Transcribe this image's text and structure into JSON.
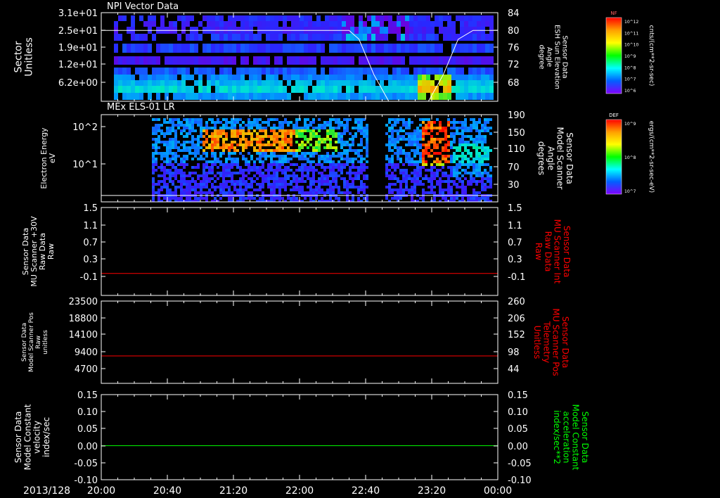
{
  "date_label": "2013/128",
  "x_axis": {
    "ticks": [
      "20:00",
      "20:40",
      "21:20",
      "22:00",
      "22:40",
      "23:20",
      "00:00"
    ]
  },
  "colorbars": [
    {
      "unit": "cnts/(cm**2-sr-sec)",
      "tag": "NF",
      "tick_labels": [
        "10^12",
        "10^11",
        "10^10",
        "10^9",
        "10^8",
        "10^7",
        "10^6"
      ],
      "colors": [
        "#ff0000",
        "#ffa000",
        "#ffff00",
        "#00ff00",
        "#00ffff",
        "#0060ff",
        "#8000ff"
      ]
    },
    {
      "unit": "ergs/(cm**2-sr-sec-eV)",
      "tag": "DEF",
      "tick_labels": [
        "10^9",
        "10^8",
        "10^7"
      ],
      "colors": [
        "#ff0000",
        "#ffa000",
        "#ffff00",
        "#00ff00",
        "#00ffff",
        "#0060ff",
        "#8000ff"
      ]
    }
  ],
  "chart_data": [
    {
      "type": "heatmap",
      "title": "NPI Vector Data",
      "left_axis": {
        "label_lines": [
          "Sector",
          "Unitless"
        ],
        "ticks": [
          "3.1e+01",
          "2.5e+01",
          "1.9e+01",
          "1.2e+01",
          "6.2e+00"
        ]
      },
      "right_axis": {
        "label_lines": [
          "Sensor Data",
          "ESH Sun Elevation",
          "Angle",
          "degree"
        ],
        "ticks": [
          "84",
          "80",
          "76",
          "72",
          "68"
        ]
      },
      "overlay_series": {
        "name": "ESH Sun Elevation Angle",
        "color": "#ffffff",
        "x_hours": [
          20.0,
          22.5,
          22.6,
          22.75,
          22.9,
          23.3,
          23.45,
          23.6,
          23.75,
          24.0
        ],
        "values": [
          80.0,
          80.0,
          78.0,
          70.0,
          64.0,
          64.0,
          70.0,
          78.0,
          80.0,
          80.0
        ],
        "ylim": [
          64,
          84
        ]
      },
      "colorbar": "NF"
    },
    {
      "type": "heatmap",
      "title": "MEx ELS-01 LR",
      "left_axis": {
        "label_lines": [
          "Electron Energy",
          "eV"
        ],
        "ticks": [
          "10^2",
          "10^1"
        ],
        "scale": "log"
      },
      "right_axis": {
        "label_lines": [
          "Sensor Data",
          "Model Scanner",
          "Angle",
          "degrees"
        ],
        "ticks": [
          "190",
          "150",
          "110",
          "70",
          "30"
        ]
      },
      "overlay_series": {
        "name": "Model Scanner Angle",
        "color": "#ffffff",
        "x_hours": [
          20.0,
          24.0
        ],
        "values": [
          14.0,
          14.0
        ],
        "ylim": [
          0,
          190
        ]
      },
      "colorbar": "DEF"
    },
    {
      "type": "line",
      "left_axis": {
        "label_lines": [
          "Sensor Data",
          "MU Scanner +30V",
          "Raw Data",
          "Raw"
        ],
        "ticks": [
          "1.5",
          "1.1",
          "0.7",
          "0.3",
          "-0.1"
        ],
        "ylim": [
          -0.5,
          1.5
        ]
      },
      "right_axis": {
        "label_lines": [
          "Sensor Data",
          "MU Scanner Int",
          "Raw Data",
          "Raw"
        ],
        "ticks": [
          "1.5",
          "1.1",
          "0.7",
          "0.3",
          "-0.1"
        ],
        "color": "#ff0000"
      },
      "series": [
        {
          "color": "#ff0000",
          "x_hours": [
            20.0,
            24.0
          ],
          "values": [
            0.0,
            0.0
          ]
        }
      ]
    },
    {
      "type": "line",
      "left_axis": {
        "label_lines": [
          "Sensor Data",
          "Model Scanner Pos",
          "Raw",
          "unitless"
        ],
        "ticks": [
          "23500",
          "18800",
          "14100",
          "9400",
          "4700"
        ],
        "ylim": [
          0,
          23500
        ]
      },
      "right_axis": {
        "label_lines": [
          "Sensor Data",
          "MU Scanner Pos",
          "Telemetry",
          "Unitless"
        ],
        "ticks": [
          "260",
          "206",
          "152",
          "98",
          "44"
        ],
        "color": "#ff0000"
      },
      "series": [
        {
          "color": "#ff0000",
          "x_hours": [
            20.0,
            24.0
          ],
          "values": [
            7840,
            7840
          ]
        }
      ]
    },
    {
      "type": "line",
      "left_axis": {
        "label_lines": [
          "Sensor Data",
          "Model Constant",
          "velocity",
          "index/sec"
        ],
        "ticks": [
          "0.15",
          "0.10",
          "0.05",
          "0.00",
          "-0.05",
          "-0.10"
        ],
        "ylim": [
          -0.1,
          0.15
        ]
      },
      "right_axis": {
        "label_lines": [
          "Sensor Data",
          "Model Constant",
          "acceleration",
          "index/sec**2"
        ],
        "ticks": [
          "0.15",
          "0.10",
          "0.05",
          "0.00",
          "-0.05",
          "-0.10"
        ],
        "color": "#00ff00"
      },
      "series": [
        {
          "color": "#00ff00",
          "x_hours": [
            20.0,
            24.0
          ],
          "values": [
            0.0,
            0.0
          ]
        }
      ]
    }
  ]
}
